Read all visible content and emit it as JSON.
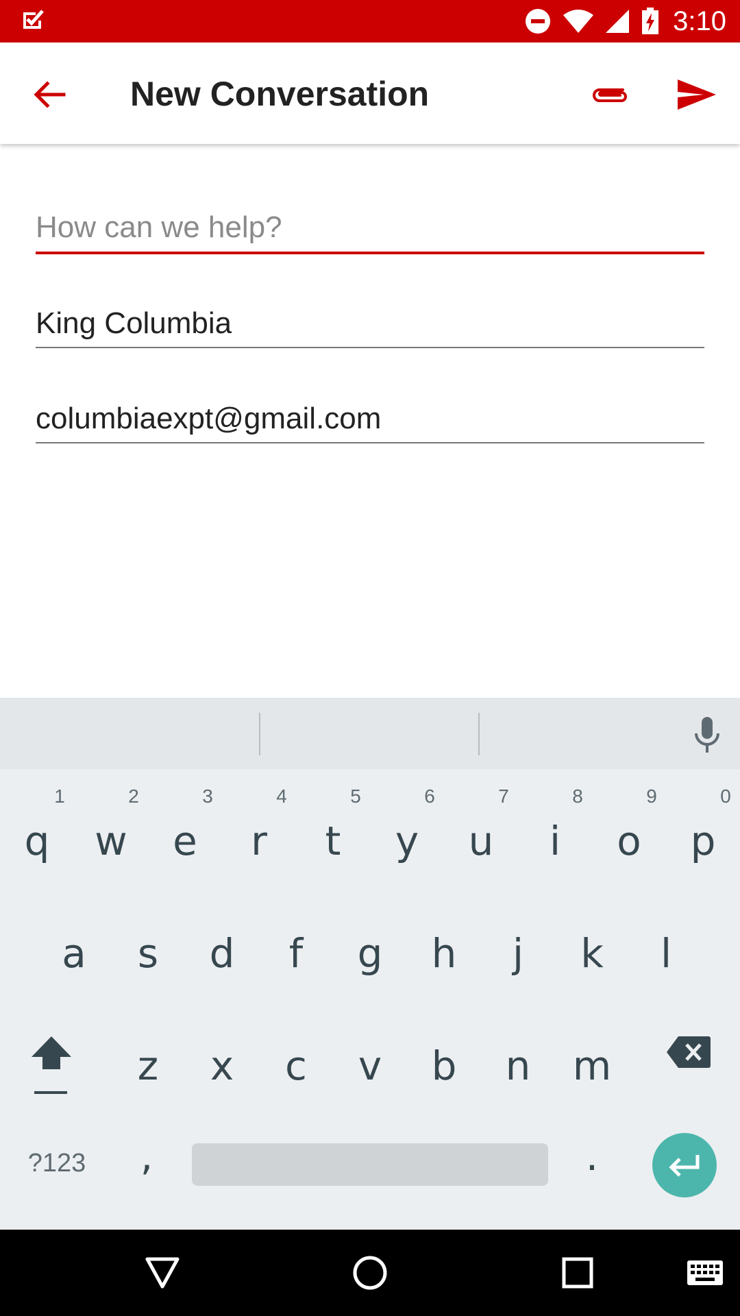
{
  "status_bar": {
    "time": "3:10",
    "icons": [
      "app-check-icon",
      "do-not-disturb-icon",
      "wifi-icon",
      "signal-icon",
      "battery-charging-icon"
    ]
  },
  "app_bar": {
    "title": "New Conversation",
    "accent": "#cc0000"
  },
  "form": {
    "message": {
      "value": "",
      "placeholder": "How can we help?"
    },
    "name": {
      "value": "King Columbia"
    },
    "email": {
      "value": "columbiaexpt@gmail.com"
    }
  },
  "keyboard": {
    "row1": [
      "q",
      "w",
      "e",
      "r",
      "t",
      "y",
      "u",
      "i",
      "o",
      "p"
    ],
    "row1_hints": [
      "1",
      "2",
      "3",
      "4",
      "5",
      "6",
      "7",
      "8",
      "9",
      "0"
    ],
    "row2": [
      "a",
      "s",
      "d",
      "f",
      "g",
      "h",
      "j",
      "k",
      "l"
    ],
    "row3": [
      "z",
      "x",
      "c",
      "v",
      "b",
      "n",
      "m"
    ],
    "symbols_label": "?123",
    "comma": ",",
    "period": ".",
    "enter_color": "#4db6ac"
  }
}
